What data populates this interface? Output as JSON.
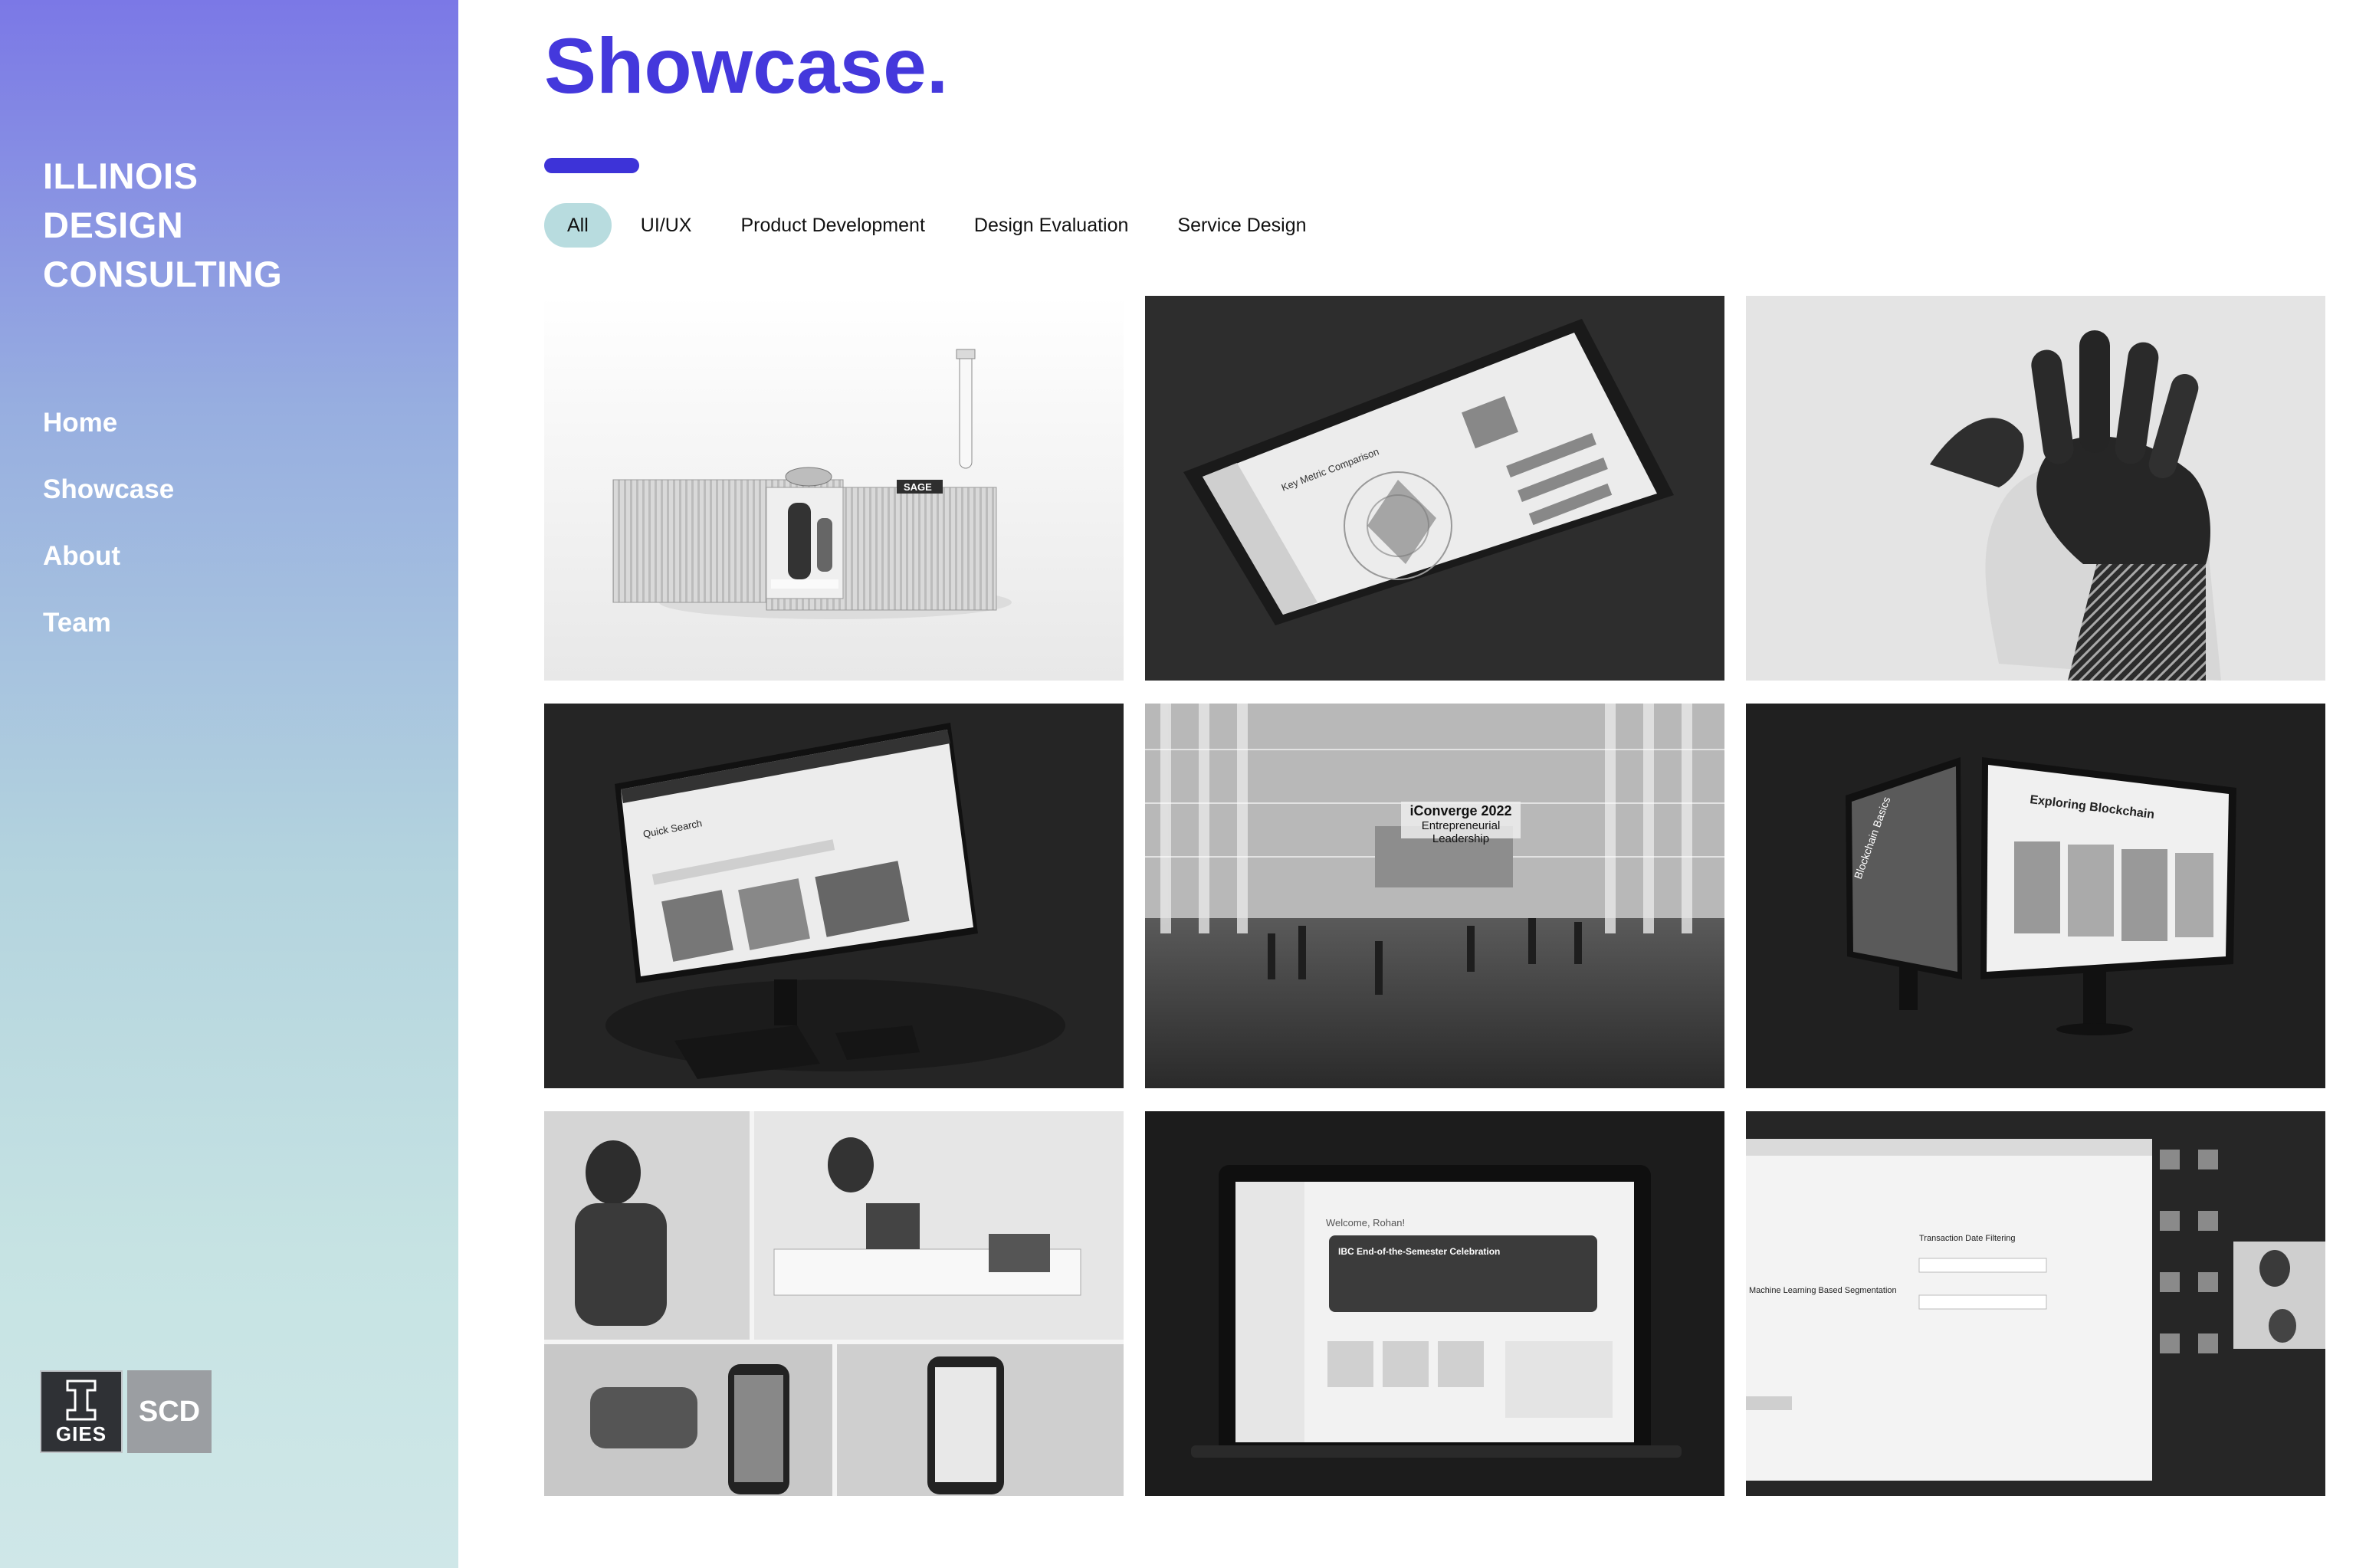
{
  "sidebar": {
    "brand_lines": [
      "ILLINOIS",
      "DESIGN",
      "CONSULTING"
    ],
    "nav": [
      {
        "label": "Home"
      },
      {
        "label": "Showcase"
      },
      {
        "label": "About"
      },
      {
        "label": "Team"
      }
    ],
    "logos": {
      "gies_label": "GIES",
      "scd_label": "SCD"
    }
  },
  "main": {
    "title": "Showcase.",
    "filters": [
      {
        "label": "All",
        "active": true
      },
      {
        "label": "UI/UX",
        "active": false
      },
      {
        "label": "Product Development",
        "active": false
      },
      {
        "label": "Design Evaluation",
        "active": false
      },
      {
        "label": "Service Design",
        "active": false
      }
    ],
    "projects": [
      {
        "image": "product-device-render",
        "text": "SAGE"
      },
      {
        "image": "tablet-ui-mockup",
        "text": "Key Metric Comparison"
      },
      {
        "image": "robotic-hand-photo"
      },
      {
        "image": "desktop-ui-mockup",
        "text": "Quick Search"
      },
      {
        "image": "event-hall-render",
        "title": "iConverge 2022",
        "subtitle": "Entrepreneurial Leadership"
      },
      {
        "image": "dual-monitor-mockup",
        "text": "Exploring Blockchain",
        "side_text": "Blockchain Basics"
      },
      {
        "image": "user-research-collage"
      },
      {
        "image": "laptop-ui-mockup",
        "greeting": "Welcome, Rohan!",
        "card_title": "IBC End-of-the-Semester Celebration"
      },
      {
        "image": "screen-share-recording",
        "text_a": "Transaction Date Filtering",
        "text_b": "Machine Learning Based Segmentation"
      }
    ]
  }
}
